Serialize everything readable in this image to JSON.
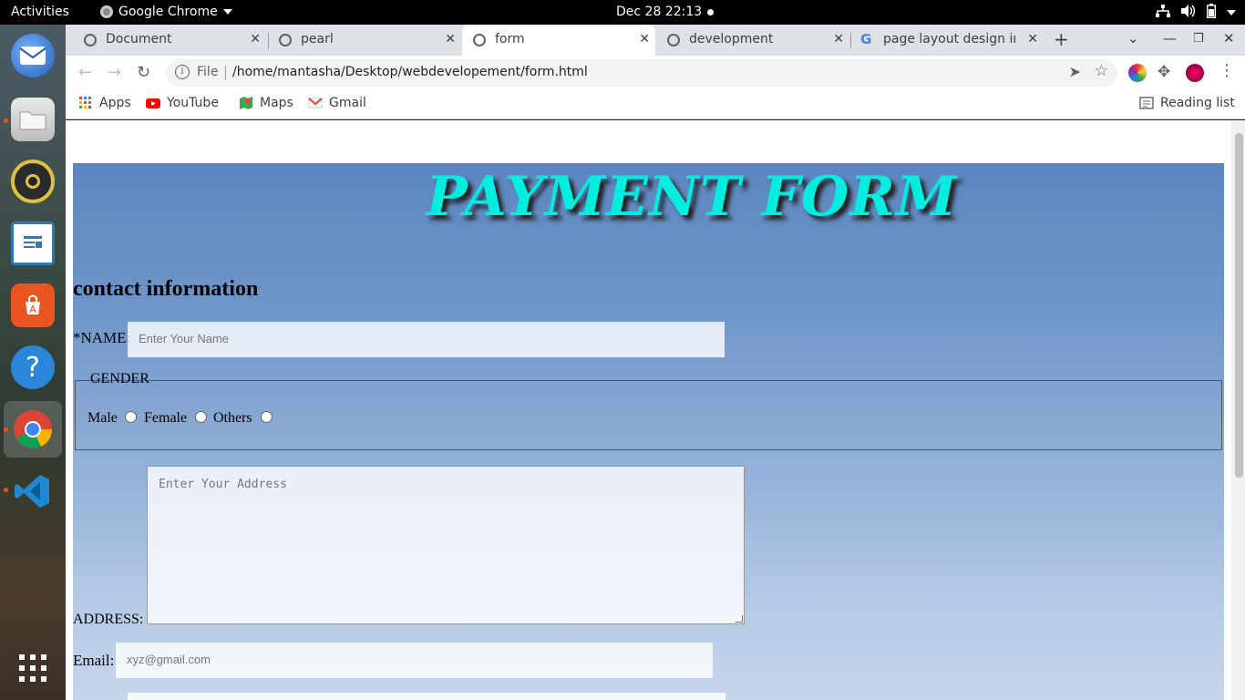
{
  "system": {
    "activities": "Activities",
    "app_name": "Google Chrome",
    "clock": "Dec 28  22:13"
  },
  "tabs": [
    {
      "title": "Document",
      "active": false
    },
    {
      "title": "pearl",
      "active": false
    },
    {
      "title": "form",
      "active": true
    },
    {
      "title": "development",
      "active": false
    },
    {
      "title": "page layout design in",
      "active": false
    }
  ],
  "address_bar": {
    "scheme": "File",
    "url": "/home/mantasha/Desktop/webdevelopement/form.html"
  },
  "bookmarks": [
    {
      "label": "Apps",
      "icon": "apps-grid-icon"
    },
    {
      "label": "YouTube",
      "icon": "youtube-icon"
    },
    {
      "label": "Maps",
      "icon": "maps-icon"
    },
    {
      "label": "Gmail",
      "icon": "gmail-icon"
    }
  ],
  "reading_list": "Reading list",
  "dock": [
    "thunderbird-icon",
    "files-icon",
    "rhythmbox-icon",
    "libreoffice-writer-icon",
    "software-center-icon",
    "help-icon",
    "chrome-icon",
    "vscode-icon",
    "show-apps-icon"
  ],
  "page": {
    "title": "PAYMENT FORM",
    "section_heading": "contact information",
    "name_label": "*NAME:",
    "name_placeholder": "Enter Your Name",
    "gender_legend": "GENDER",
    "gender_options": [
      "Male",
      "Female",
      "Others"
    ],
    "address_label": "ADDRESS:",
    "address_placeholder": "Enter Your Address",
    "email_label": "Email:",
    "email_placeholder": "xyz@gmail.com"
  },
  "colors": {
    "title": "#00ede0",
    "form_bg_top": "#5c86c0",
    "form_bg_bottom": "#c9d8ec"
  }
}
